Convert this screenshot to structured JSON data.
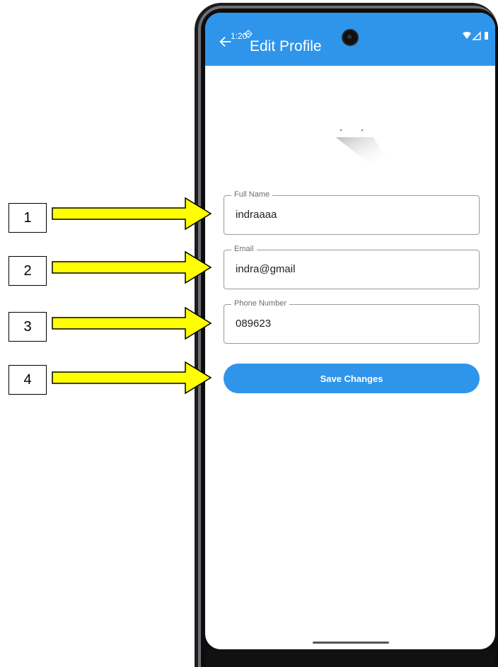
{
  "status_bar": {
    "time": "1:20"
  },
  "app_bar": {
    "title": "Edit Profile"
  },
  "form": {
    "full_name": {
      "label": "Full Name",
      "value": "indraaaa"
    },
    "email": {
      "label": "Email",
      "value": "indra@gmail"
    },
    "phone": {
      "label": "Phone Number",
      "value": "089623"
    },
    "save_label": "Save Changes"
  },
  "annotations": [
    {
      "number": "1"
    },
    {
      "number": "2"
    },
    {
      "number": "3"
    },
    {
      "number": "4"
    }
  ],
  "colors": {
    "accent": "#2f95ea",
    "arrow_fill": "#ffff00"
  },
  "icons": [
    "back-arrow-icon",
    "location-icon",
    "wifi-icon",
    "signal-icon",
    "battery-icon",
    "camera-icon"
  ]
}
